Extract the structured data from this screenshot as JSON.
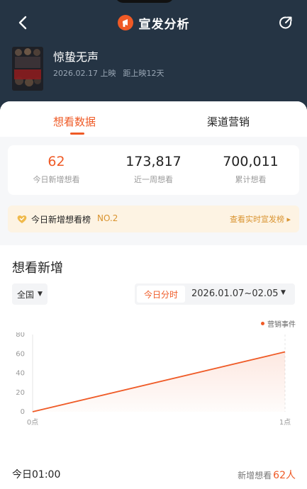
{
  "header": {
    "title": "宣发分析",
    "movie_title": "惊蛰无声",
    "release_date": "2026.02.17 上映",
    "days_to_release": "距上映12天",
    "poster_text": "谁在泄密？春节揭秘！"
  },
  "tabs": [
    {
      "label": "想看数据",
      "active": true
    },
    {
      "label": "渠道营销",
      "active": false
    }
  ],
  "stats": [
    {
      "value": "62",
      "label": "今日新增想看"
    },
    {
      "value": "173,817",
      "label": "近一周想看"
    },
    {
      "value": "700,011",
      "label": "累计想看"
    }
  ],
  "rank": {
    "label": "今日新增想看榜",
    "position": "NO.2",
    "link": "查看实时宣发榜 ▸"
  },
  "section": {
    "title": "想看新增",
    "region": "全国",
    "today_label": "今日分时",
    "date_range": "2026.01.07~02.05",
    "legend": "营销事件"
  },
  "chart_data": {
    "type": "line",
    "x": [
      "0点",
      "1点"
    ],
    "values": [
      0,
      62
    ],
    "y_ticks": [
      0,
      20,
      40,
      60,
      80
    ],
    "ylim": [
      0,
      80
    ],
    "color": "#ef5a26",
    "grid": false
  },
  "footer": {
    "time": "今日01:00",
    "stat_label": "新增想看",
    "stat_value": "62人"
  },
  "colors": {
    "accent": "#ef5a26",
    "header_bg": "#253444",
    "rank_bg": "#fdf3e3",
    "rank_text": "#d9932f"
  }
}
